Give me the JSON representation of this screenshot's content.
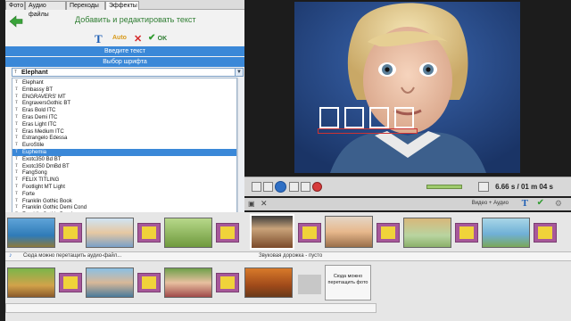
{
  "tabs": [
    "Фото",
    "Аудио файлы",
    "Переходы",
    "Эффекты"
  ],
  "panel": {
    "title": "Добавить и редактировать текст",
    "auto_label": "Auto",
    "ok_label": "OK",
    "bar1": "Введите текст",
    "bar2": "Выбор шрифта",
    "selected_font": "Elephant"
  },
  "fonts": [
    "Elephant",
    "Embassy BT",
    "ENGRAVERS' MT",
    "EngraversGothic BT",
    "Eras Bold ITC",
    "Eras Demi ITC",
    "Eras Light ITC",
    "Eras Medium ITC",
    "Estrangelo Edessa",
    "EuroStile",
    "Euphemia",
    "Exotc350 Bd BT",
    "Exotc350 DmBd BT",
    "FangSong",
    "FELIX TITLING",
    "Footlight MT Light",
    "Forte",
    "Franklin Gothic Book",
    "Franklin Gothic Demi Cond",
    "Franklin Gothic Demi"
  ],
  "font_highlight_index": 10,
  "player": {
    "time": "6.66 s / 01 m 04 s"
  },
  "timeline": {
    "toolbar_label": "Видео + Аудио"
  },
  "audio": {
    "drop_hint": "Сюда можно перетащить аудио-файл...",
    "track_empty": "Звуковая дорожка - пусто"
  },
  "drop_box": "Сюда можно перетащить фото",
  "colors": {
    "accent_blue": "#3a88d8",
    "title_green": "#2f7d32",
    "transition_purple": "#a7589a",
    "transition_yellow": "#f0d33a"
  }
}
